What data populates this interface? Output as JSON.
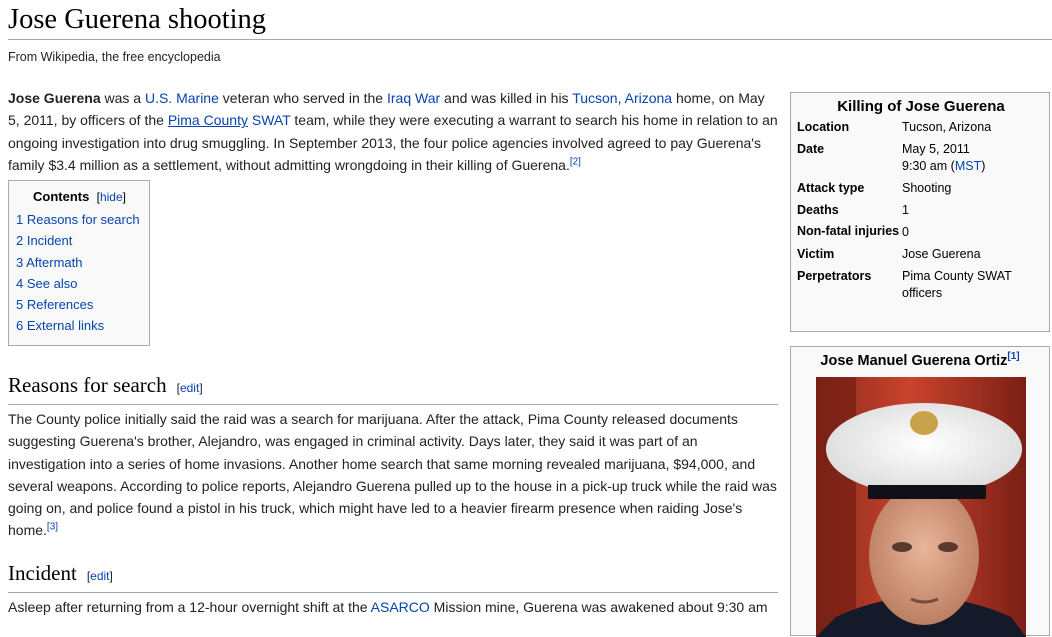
{
  "page": {
    "title": "Jose Guerena shooting",
    "tagline": "From Wikipedia, the free encyclopedia"
  },
  "lead": {
    "subject": "Jose Guerena",
    "t1": " was a ",
    "link_marine": "U.S. Marine",
    "t2": " veteran who served in the ",
    "link_iraq": "Iraq War",
    "t3": " and was killed in his ",
    "link_tucson": "Tucson",
    "t4": ", ",
    "link_arizona": "Arizona",
    "t5": " home, on May 5, 2011, by officers of the ",
    "link_pima": "Pima County",
    "t6": " ",
    "link_swat": "SWAT",
    "t7": " team, while they were executing a warrant to search his home in relation to an ongoing investigation into drug smuggling. In September 2013, the four police agencies involved agreed to pay Guerena's family $3.4 million as a settlement, without admitting wrongdoing in their killing of Guerena.",
    "ref": "[2]"
  },
  "toc": {
    "title": "Contents",
    "hide_open": "[",
    "hide": "hide",
    "hide_close": "]",
    "items": [
      "1 Reasons for search",
      "2 Incident",
      "3 Aftermath",
      "4 See also",
      "5 References",
      "6 External links"
    ]
  },
  "sections": {
    "reasons": {
      "heading": "Reasons for search",
      "edit_open": "[",
      "edit": "edit",
      "edit_close": "]",
      "text": "The County police initially said the raid was a search for marijuana. After the attack, Pima County released documents suggesting Guerena's brother, Alejandro, was engaged in criminal activity. Days later, they said it was part of an investigation into a series of home invasions. Another home search that same morning revealed marijuana, $94,000, and several weapons. According to police reports, Alejandro Guerena pulled up to the house in a pick-up truck while the raid was going on, and police found a pistol in his truck, which might have led to a heavier firearm presence when raiding Jose's home.",
      "ref": "[3]"
    },
    "incident": {
      "heading": "Incident",
      "edit_open": "[",
      "edit": "edit",
      "edit_close": "]",
      "t1": "Asleep after returning from a 12-hour overnight shift at the ",
      "link_asarco": "ASARCO",
      "t2": " Mission mine, Guerena was awakened about 9:30 am"
    }
  },
  "infobox": {
    "title": "Killing of Jose Guerena",
    "location_label": "Location",
    "location_value": "Tucson, Arizona",
    "date_label": "Date",
    "date_value": "May 5, 2011",
    "time_value": "9:30 am (",
    "time_zone": "MST",
    "time_close": ")",
    "attack_label": "Attack type",
    "attack_value": "Shooting",
    "deaths_label": "Deaths",
    "deaths_value": "1",
    "nonfatal_label": "Non-fatal injuries",
    "nonfatal_value": "0",
    "victim_label": "Victim",
    "victim_value": "Jose Guerena",
    "perp_label": "Perpetrators",
    "perp_value": "Pima County SWAT officers"
  },
  "image": {
    "caption": "Jose Manuel Guerena Ortiz",
    "ref": "[1]"
  },
  "colors": {
    "link": "#0645ad",
    "infobox_bg": "#f9f9f9",
    "border": "#aaaaaa"
  }
}
